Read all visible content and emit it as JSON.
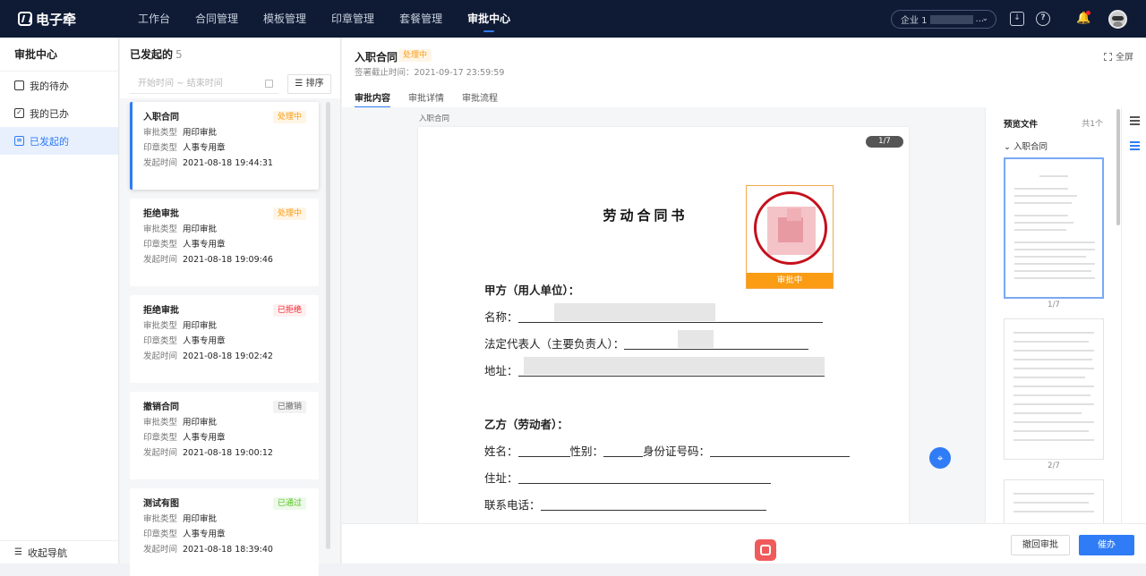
{
  "brand": {
    "name": "电子牵"
  },
  "nav": {
    "items": [
      "工作台",
      "合同管理",
      "模板管理",
      "印章管理",
      "套餐管理",
      "审批中心"
    ],
    "active_index": 5
  },
  "topbar": {
    "company_prefix": "企业 1",
    "company_suffix": "..."
  },
  "sidebar": {
    "title": "审批中心",
    "items": [
      {
        "label": "我的待办",
        "icon": "calendar-icon"
      },
      {
        "label": "我的已办",
        "icon": "checkbox-icon"
      },
      {
        "label": "已发起的",
        "icon": "document-icon"
      }
    ],
    "active_index": 2,
    "footer": "收起导航"
  },
  "list": {
    "title": "已发起的",
    "count": "5",
    "date_placeholder": "开始时间 ~ 结束时间",
    "sort_label": "排序",
    "field_labels": {
      "approval_type": "审批类型",
      "seal_type": "印章类型",
      "start_time": "发起时间"
    },
    "cards": [
      {
        "title": "入职合同",
        "status": "处理中",
        "status_kind": "processing",
        "approval_type": "用印审批",
        "seal_type": "人事专用章",
        "start_time": "2021-08-18 19:44:31"
      },
      {
        "title": "拒绝审批",
        "status": "处理中",
        "status_kind": "processing",
        "approval_type": "用印审批",
        "seal_type": "人事专用章",
        "start_time": "2021-08-18 19:09:46"
      },
      {
        "title": "拒绝审批",
        "status": "已拒绝",
        "status_kind": "rejected",
        "approval_type": "用印审批",
        "seal_type": "人事专用章",
        "start_time": "2021-08-18 19:02:42"
      },
      {
        "title": "撤销合同",
        "status": "已撤销",
        "status_kind": "revoked",
        "approval_type": "用印审批",
        "seal_type": "人事专用章",
        "start_time": "2021-08-18 19:00:12"
      },
      {
        "title": "测试有图",
        "status": "已通过",
        "status_kind": "passed",
        "approval_type": "用印审批",
        "seal_type": "人事专用章",
        "start_time": "2021-08-18 18:39:40"
      }
    ]
  },
  "detail": {
    "title": "入职合同",
    "status": "处理中",
    "deadline": "签署截止时间：2021-09-17 23:59:59",
    "fullscreen": "全屏",
    "tabs": [
      "审批内容",
      "审批详情",
      "审批流程"
    ],
    "active_tab": 0,
    "doc_label": "入职合同",
    "page_indicator": "1/7",
    "seal_status": "审批中",
    "contract": {
      "heading": "劳动合同书",
      "party_a": "甲方（用人单位）：",
      "name_label": "名称：",
      "rep_label": "法定代表人（主要负责人）：",
      "addr_label": "地址：",
      "party_b": "乙方（劳动者）：",
      "b_name_label": "姓名：",
      "gender_label": "性别：",
      "id_label": "身份证号码：",
      "b_addr_label": "住址：",
      "phone_label": "联系电话："
    },
    "buttons": {
      "withdraw": "撤回审批",
      "remind": "催办"
    }
  },
  "preview": {
    "title": "预览文件",
    "count": "共1个",
    "group": "入职合同",
    "pages": [
      "1/7",
      "2/7"
    ]
  },
  "colors": {
    "primary": "#2f7cf6",
    "topbar": "#0f1b35",
    "processing": "#fa9c14",
    "seal": "#c5101c"
  }
}
